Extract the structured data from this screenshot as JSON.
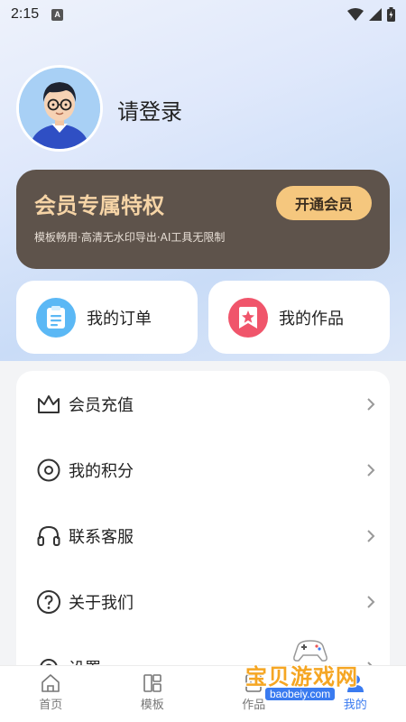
{
  "status_bar": {
    "time": "2:15",
    "notif_letter": "A"
  },
  "profile": {
    "login_label": "请登录"
  },
  "vip": {
    "title": "会员专属特权",
    "subtitle": "模板畅用·高清无水印导出·AI工具无限制",
    "button_label": "开通会员",
    "colors": {
      "card": "#5e534b",
      "title": "#f6d4a6",
      "button": "#f5c77e"
    }
  },
  "quick": [
    {
      "label": "我的订单",
      "icon": "order-list-icon",
      "color": "#5bb8f5"
    },
    {
      "label": "我的作品",
      "icon": "star-works-icon",
      "color": "#f0556b"
    }
  ],
  "menu": [
    {
      "label": "会员充值",
      "icon": "crown-icon"
    },
    {
      "label": "我的积分",
      "icon": "points-icon"
    },
    {
      "label": "联系客服",
      "icon": "headset-icon"
    },
    {
      "label": "关于我们",
      "icon": "question-icon"
    },
    {
      "label": "设置",
      "icon": "gear-icon"
    }
  ],
  "tabs": [
    {
      "label": "首页",
      "icon": "home-icon"
    },
    {
      "label": "模板",
      "icon": "template-icon"
    },
    {
      "label": "作品",
      "icon": "works-icon"
    },
    {
      "label": "我的",
      "icon": "profile-icon",
      "active": true
    }
  ],
  "watermark": {
    "text": "宝贝游戏网",
    "url": "baobeiy.com"
  }
}
